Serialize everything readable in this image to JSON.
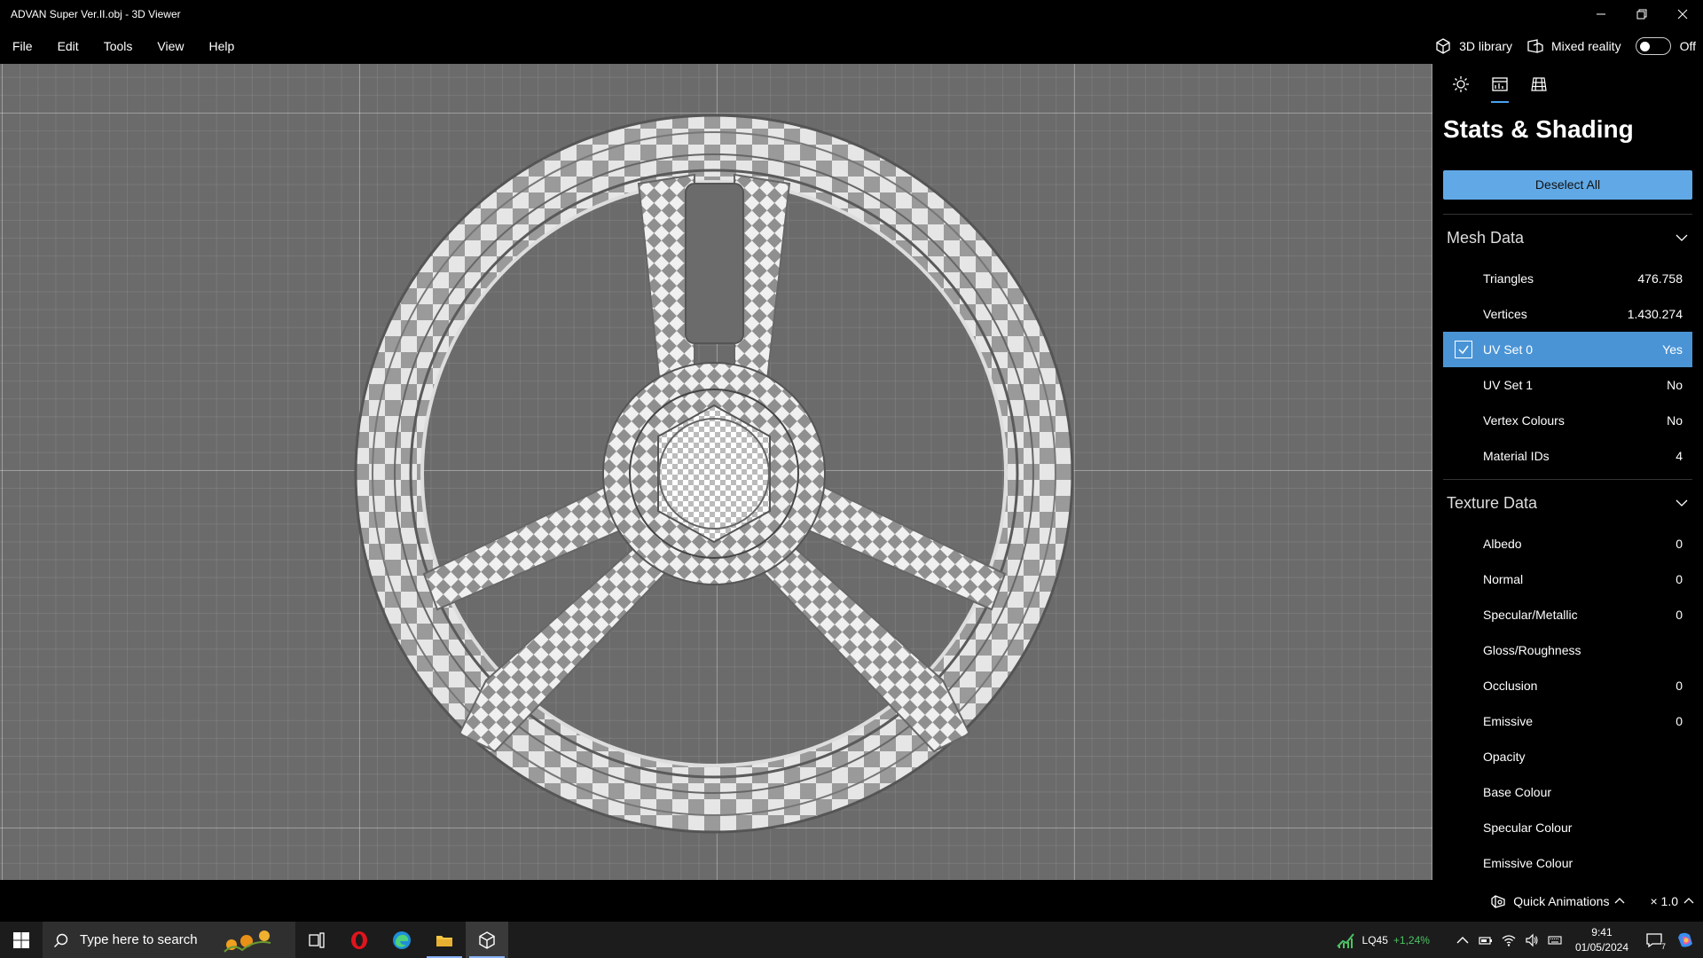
{
  "window": {
    "title": "ADVAN Super Ver.II.obj - 3D Viewer"
  },
  "menu": {
    "items": [
      "File",
      "Edit",
      "Tools",
      "View",
      "Help"
    ]
  },
  "toolbar": {
    "library_label": "3D library",
    "mixed_reality_label": "Mixed reality",
    "mixed_reality_state": "Off"
  },
  "panel": {
    "title": "Stats & Shading",
    "deselect_label": "Deselect All",
    "mesh_section": "Mesh Data",
    "mesh_rows": [
      {
        "label": "Triangles",
        "value": "476.758"
      },
      {
        "label": "Vertices",
        "value": "1.430.274"
      },
      {
        "label": "UV Set 0",
        "value": "Yes",
        "checked": true
      },
      {
        "label": "UV Set 1",
        "value": "No"
      },
      {
        "label": "Vertex Colours",
        "value": "No"
      },
      {
        "label": "Material IDs",
        "value": "4"
      }
    ],
    "texture_section": "Texture Data",
    "texture_rows": [
      {
        "label": "Albedo",
        "value": "0"
      },
      {
        "label": "Normal",
        "value": "0"
      },
      {
        "label": "Specular/Metallic",
        "value": "0"
      },
      {
        "label": "Gloss/Roughness",
        "value": ""
      },
      {
        "label": "Occlusion",
        "value": "0"
      },
      {
        "label": "Emissive",
        "value": "0"
      },
      {
        "label": "Opacity",
        "value": ""
      },
      {
        "label": "Base Colour",
        "value": ""
      },
      {
        "label": "Specular Colour",
        "value": ""
      },
      {
        "label": "Emissive Colour",
        "value": ""
      }
    ]
  },
  "bottom": {
    "quick_animations": "Quick Animations",
    "speed": "× 1.0"
  },
  "taskbar": {
    "search_placeholder": "Type here to search",
    "stock_name": "LQ45",
    "stock_change": "+1,24%",
    "time": "9:41",
    "date": "01/05/2024",
    "notification_count": "7"
  },
  "colors": {
    "accent": "#61a9e6",
    "selected_row": "#4a94d6",
    "stock_up": "#4cc263"
  }
}
